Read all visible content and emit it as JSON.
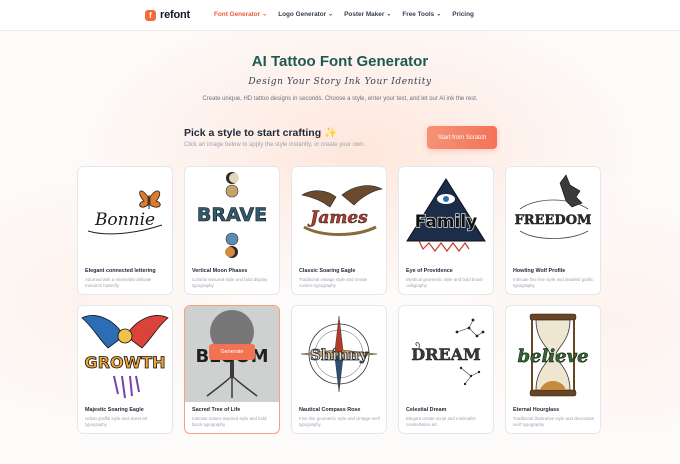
{
  "nav": {
    "brand": "refont",
    "brand_mark": "f",
    "items": [
      {
        "label": "Font Generator",
        "dropdown": true,
        "active": true
      },
      {
        "label": "Logo Generator",
        "dropdown": true,
        "active": false
      },
      {
        "label": "Poster Maker",
        "dropdown": true,
        "active": false
      },
      {
        "label": "Free Tools",
        "dropdown": true,
        "active": false
      },
      {
        "label": "Pricing",
        "dropdown": false,
        "active": false
      }
    ]
  },
  "hero": {
    "title": "AI Tattoo Font Generator",
    "subtitle": "Design Your Story Ink Your Identity",
    "description": "Create unique, HD tattoo designs in seconds. Choose a style, enter your text, and let our AI ink the rest."
  },
  "picker": {
    "title": "Pick a style to start crafting",
    "title_emoji": "✨",
    "description": "Click an image below to apply the style instantly, or create your own.",
    "start_button": "Start from Scratch"
  },
  "generate_label": "Generate",
  "colors": {
    "accent": "#f47357",
    "brand": "#f26c3b",
    "title": "#1e5a53"
  },
  "cards": [
    {
      "art_text": "Bonnie",
      "title": "Elegant connected lettering",
      "description": "Adorned with a minimalist delicate monarch butterfly",
      "icon": "butterfly-icon"
    },
    {
      "art_text": "BRAVE",
      "title": "Vertical Moon Phases",
      "description": "Colorful textured style and bold display typography",
      "icon": "moon-phases-icon"
    },
    {
      "art_text": "James",
      "title": "Classic Soaring Eagle",
      "description": "Traditional vintage style and ornate cursive typography",
      "icon": "eagle-icon"
    },
    {
      "art_text": "Family",
      "title": "Eye of Providence",
      "description": "Mystical geometric style and bold brush calligraphy",
      "icon": "eye-triangle-icon"
    },
    {
      "art_text": "FREEDOM",
      "title": "Howling Wolf Profile",
      "description": "Intricate fine line style and detailed gothic typography",
      "icon": "wolf-icon"
    },
    {
      "art_text": "GROWTH",
      "title": "Majestic Soaring Eagle",
      "description": "Urban graffiti style and street art typography",
      "icon": "eagle-wings-icon"
    },
    {
      "art_text": "BLOOM",
      "title": "Sacred Tree of Life",
      "description": "Intricate nature-inspired style and bold block typography",
      "icon": "tree-icon",
      "selected": true
    },
    {
      "art_text": "Shinny",
      "title": "Nautical Compass Rose",
      "description": "Fine line geometric style and vintage serif typography",
      "icon": "compass-icon"
    },
    {
      "art_text": "DREAM",
      "title": "Celestial Dream",
      "description": "Elegant ornate script and minimalist constellation art",
      "icon": "constellation-icon"
    },
    {
      "art_text": "believe",
      "title": "Eternal Hourglass",
      "description": "Traditional illustrative style and decorative serif typography",
      "icon": "hourglass-icon"
    }
  ]
}
